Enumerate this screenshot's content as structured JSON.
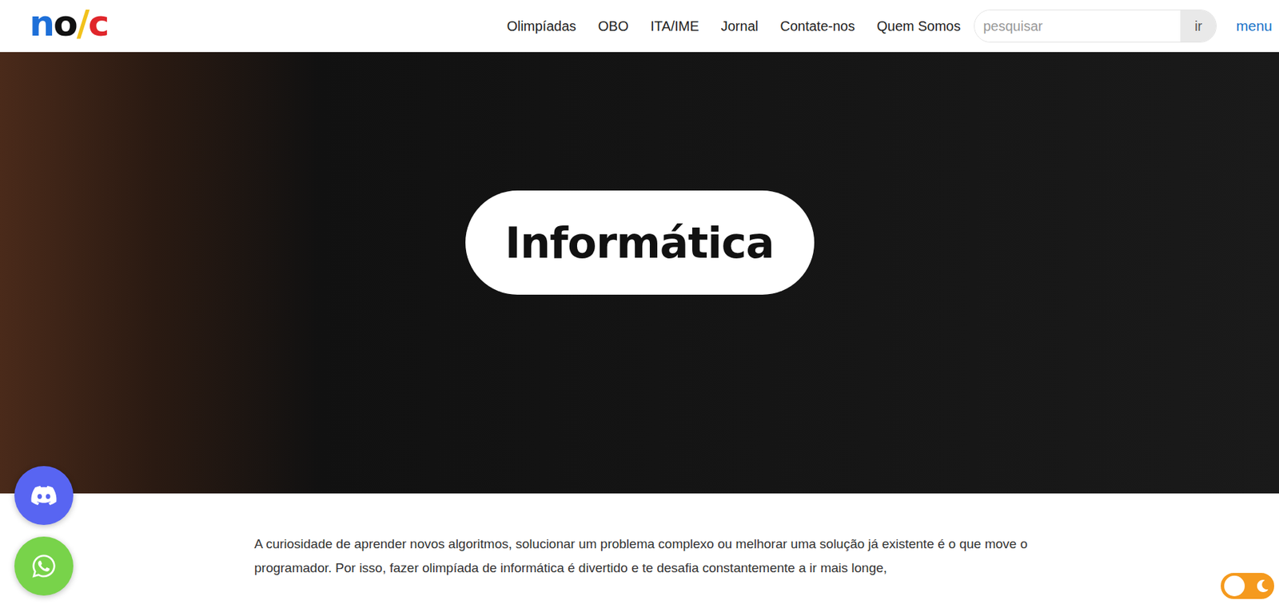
{
  "logo": {
    "letters": [
      {
        "char": "n",
        "color": "#1d6fd8"
      },
      {
        "char": "o",
        "color": "#111111"
      },
      {
        "char": "/",
        "color": "#f2c21b"
      },
      {
        "char": "c",
        "color": "#e0262b"
      }
    ]
  },
  "nav": {
    "items": [
      "Olimpíadas",
      "OBO",
      "ITA/IME",
      "Jornal",
      "Contate-nos",
      "Quem Somos"
    ]
  },
  "search": {
    "placeholder": "pesquisar",
    "button": "ir"
  },
  "menu": "menu",
  "hero": {
    "title": "Informática"
  },
  "content": {
    "paragraph": "A curiosidade de aprender novos algoritmos, solucionar um problema complexo ou melhorar uma solução já existente é o que move o programador. Por isso, fazer olimpíada de informática é divertido e te desafia constantemente a ir mais longe,"
  },
  "floating": [
    {
      "kind": "discord",
      "color": "#5865f2"
    },
    {
      "kind": "whatsapp",
      "color": "#78d34a"
    }
  ],
  "theme_toggle": {
    "dark_mode": false
  }
}
